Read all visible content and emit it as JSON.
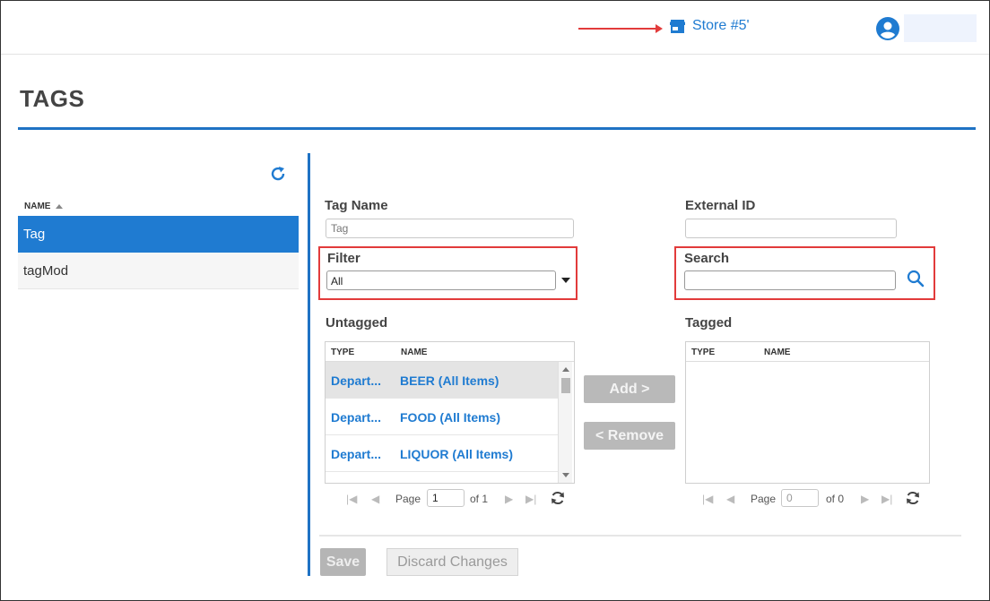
{
  "header": {
    "store_name": "Store #5'",
    "store_icon": "store-icon",
    "user_icon": "account-circle-icon"
  },
  "page": {
    "title": "TAGS"
  },
  "sidebar": {
    "column_header": "NAME",
    "items": [
      {
        "label": "Tag",
        "selected": true
      },
      {
        "label": "tagMod",
        "selected": false
      }
    ]
  },
  "form": {
    "tag_name_label": "Tag Name",
    "tag_name_value": "Tag",
    "external_id_label": "External ID",
    "external_id_value": "",
    "filter_label": "Filter",
    "filter_value": "All",
    "search_label": "Search",
    "search_value": ""
  },
  "untagged": {
    "label": "Untagged",
    "columns": [
      "TYPE",
      "NAME"
    ],
    "rows": [
      {
        "type": "Depart...",
        "name": "BEER (All Items)",
        "selected": true
      },
      {
        "type": "Depart...",
        "name": "FOOD (All Items)",
        "selected": false
      },
      {
        "type": "Depart...",
        "name": "LIQUOR (All Items)",
        "selected": false
      }
    ],
    "pager": {
      "page_label": "Page",
      "page": "1",
      "of_label": "of 1"
    }
  },
  "tagged": {
    "label": "Tagged",
    "columns": [
      "TYPE",
      "NAME"
    ],
    "rows": [],
    "pager": {
      "page_label": "Page",
      "page": "0",
      "of_label": "of 0"
    }
  },
  "actions": {
    "add_label": "Add >",
    "remove_label": "< Remove",
    "save_label": "Save",
    "discard_label": "Discard Changes"
  },
  "colors": {
    "accent": "#1f7bd1",
    "highlight_border": "#e23b3b",
    "selected_row": "#1f7bd1"
  }
}
